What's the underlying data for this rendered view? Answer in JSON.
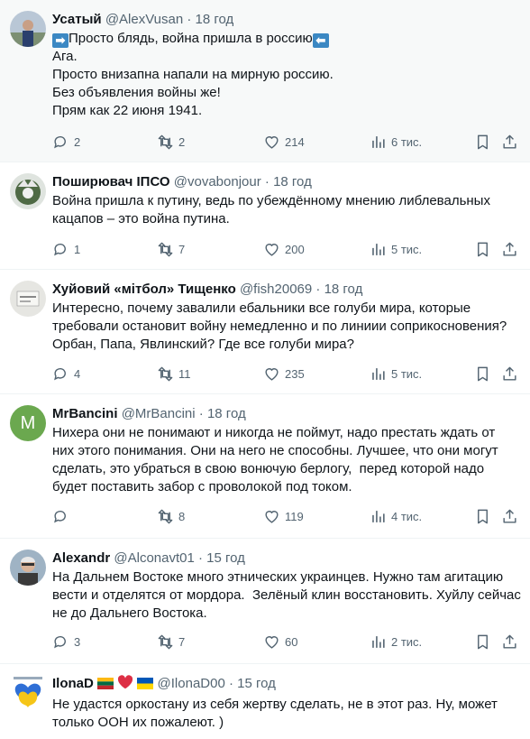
{
  "replies": [
    {
      "name": "Усатый",
      "handle": "@AlexVusan",
      "time": "18 год",
      "lines": [
        "Просто блядь, война пришла в россию",
        "Ага.",
        "Просто внизапна напали на мирную россию.",
        "Без объявления войны же!",
        "Прям как 22 июня 1941."
      ],
      "arrow_left": "➡",
      "arrow_right": "⬅",
      "replies": "2",
      "reposts": "2",
      "likes": "214",
      "views": "6 тис."
    },
    {
      "name": "Поширювач ІПСО",
      "handle": "@vovabonjour",
      "time": "18 год",
      "lines": [
        "Война пришла к путину, ведь по убеждённому мнению либлевальных",
        "кацапов – это война путина."
      ],
      "replies": "1",
      "reposts": "7",
      "likes": "200",
      "views": "5 тис."
    },
    {
      "name": "Хуйовий «мітбол» Тищенко",
      "handle": "@fish20069",
      "time": "18 год",
      "lines": [
        "Интересно, почему завалили ебальники все голуби мира, которые",
        "требовали остановит войну немедленно и по линиии соприкосновения?",
        "Орбан, Папа, Явлинский? Где все голуби мира?"
      ],
      "replies": "4",
      "reposts": "11",
      "likes": "235",
      "views": "5 тис."
    },
    {
      "name": "MrBancini",
      "handle": "@MrBancini",
      "time": "18 год",
      "avatar_letter": "M",
      "lines": [
        "Нихера они не понимают и никогда не поймут, надо престать ждать от",
        "них этого понимания. Они на него не способны. Лучшее, что они могут",
        "сделать, это убраться в свою вонючую берлогу,  перед которой надо",
        "будет поставить забор с проволокой под током."
      ],
      "replies": "",
      "reposts": "8",
      "likes": "119",
      "views": "4 тис."
    },
    {
      "name": "Alexandr",
      "handle": "@Alconavt01",
      "time": "15 год",
      "lines": [
        "На Дальнем Востоке много этнических украинцев. Нужно там агитацию",
        "вести и отделятся от мордора.  Зелёный клин восстановить. Хуйлу сейчас",
        "не до Дальнего Востока."
      ],
      "replies": "3",
      "reposts": "7",
      "likes": "60",
      "views": "2 тис."
    },
    {
      "name": "IlonaD",
      "handle": "@IlonaD00",
      "time": "15 год",
      "lines": [
        "Не удастся оркостану из себя жертву сделать, не в этот раз. Ну, может",
        "только ООН их пожалеют. )"
      ]
    }
  ],
  "separator": "·",
  "colors": {
    "text": "#0f1419",
    "muted": "#536471",
    "divider": "#eff3f4",
    "highlight_bg": "#f7f9f9",
    "green_avatar": "#6ba84f"
  },
  "icons": [
    "reply-icon",
    "repost-icon",
    "like-icon",
    "views-icon",
    "bookmark-icon",
    "share-icon"
  ]
}
